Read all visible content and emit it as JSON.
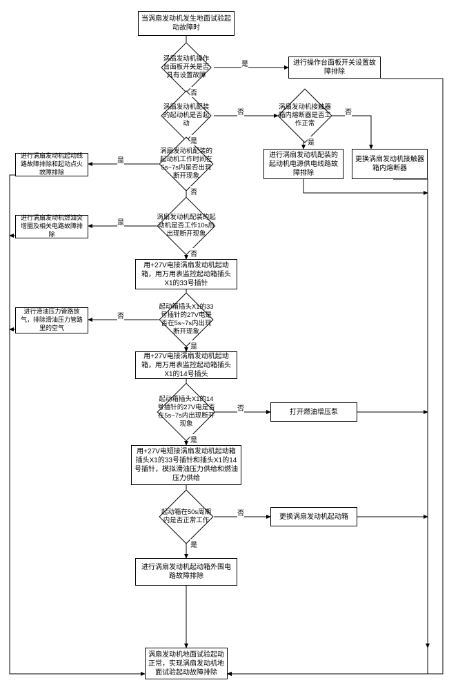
{
  "nodes": {
    "start": "当涡扇发动机发生地面试验起动故障时",
    "d1": "涡扇发动机操作台面板开关是否具有设置故障",
    "d1_yes_action": "进行操作台面板开关设置故障排除",
    "d2": "涡扇发动机配装的起动机是否起动",
    "d2_no_d": "涡扇发动机接触器箱内熔断器是否工作正常",
    "d2_no_yes_action": "进行涡扇发动机配装的起动机电源供电线路故障排除",
    "d2_no_no_action": "更换涡扇发动机接触器箱内熔断器",
    "d3": "涡扇发动机配装的起动机工作时间在5s~7s内是否出现断开现象",
    "d3_yes_action": "进行涡扇发动机起动线路故障排除和起动点火故障排除",
    "d4": "涡扇发动机配装的起动机是否工作10s后出现断开现象",
    "d4_yes_action": "进行涡扇发动机燃油突增圈及相关电路故障排除",
    "p5": "用+27V电接涡扇发动机起动箱，用万用表监控起动箱插头X1的33号插针",
    "d6": "起动箱插头X1的33号插针的27V电是否在5s~7s内出现断开现象",
    "d6_no_action": "进行滑油压力管路放气，排除滑油压力管路里的空气",
    "p7": "用+27V电接涡扇发动机起动箱，用万用表监控起动箱插头X1的14号插头",
    "d8": "起动箱插头X1的14号插针的27V电是否在5s~7s内出现断开现象",
    "d8_no_action": "打开燃油增压泵",
    "p9": "用+27V电短接涡扇发动机起动箱插头X1的33号插针和插头X1的14号插针，模拟滑油压力供给和燃油压力供给",
    "d10": "起动箱在50s周期内是否正常工作",
    "d10_no_action": "更换涡扇发动机起动箱",
    "p11": "进行涡扇发动机起动箱外围电路故障排除",
    "end": "涡扇发动机地面试验起动正常，实现涡扇发动机地面试验起动故障排除"
  },
  "labels": {
    "yes": "是",
    "no": "否"
  }
}
